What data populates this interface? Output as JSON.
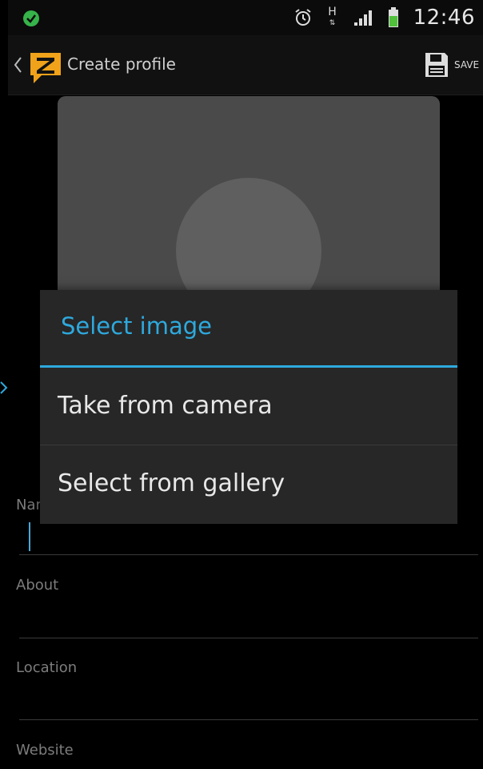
{
  "status_bar": {
    "time": "12:46",
    "network": "H"
  },
  "action_bar": {
    "title": "Create profile",
    "save_label": "SAVE"
  },
  "fields": {
    "name_label": "Nar",
    "about_label": "About",
    "location_label": "Location",
    "website_label": "Website"
  },
  "dialog": {
    "title": "Select image",
    "options": [
      {
        "label": "Take from camera"
      },
      {
        "label": "Select from gallery"
      }
    ]
  },
  "colors": {
    "accent": "#2ea9dd",
    "dialog_bg": "#272727",
    "logo": "#f0a21a"
  }
}
